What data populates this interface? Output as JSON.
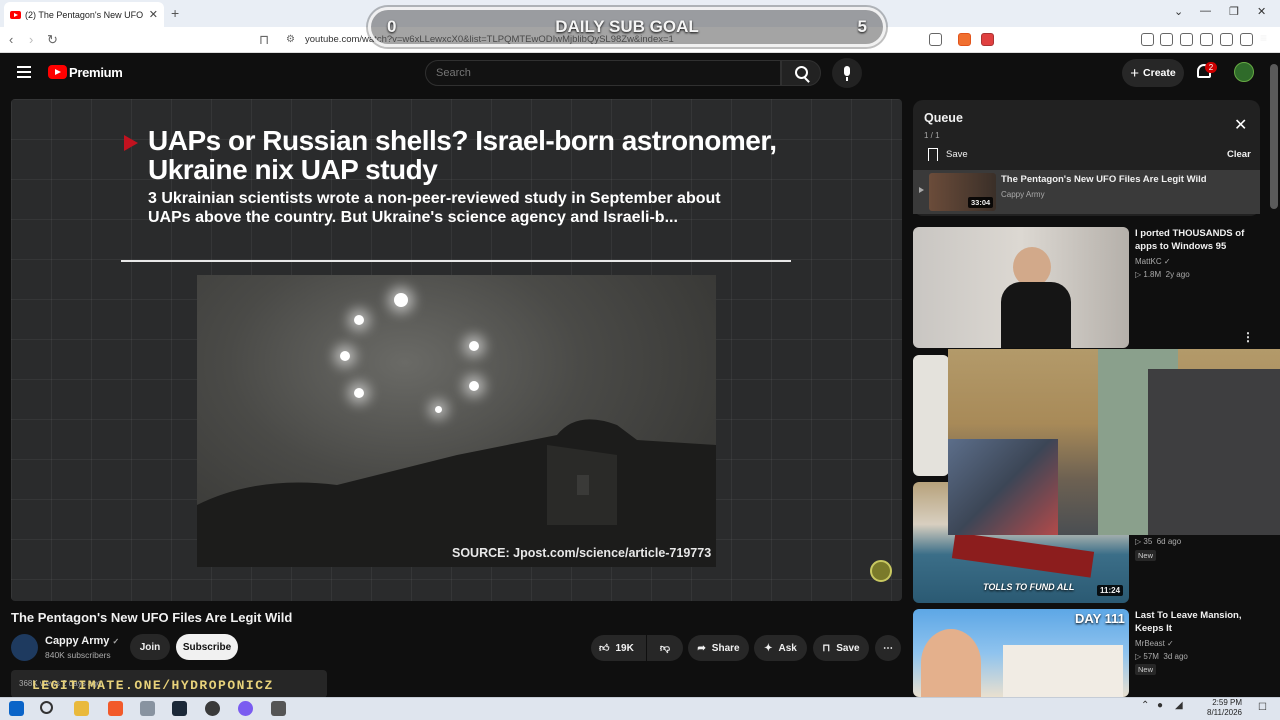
{
  "browser": {
    "tab_title": "(2) The Pentagon's New UFO",
    "url": "youtube.com/watch?v=w6xLLewxcX0&list=TLPQMTEwODIwMjblibQySL98Zw&index=1",
    "notification_count": "2"
  },
  "goal_overlay": {
    "current": "0",
    "label": "DAILY SUB GOAL",
    "target": "5"
  },
  "header": {
    "brand": "Premium",
    "search_placeholder": "Search",
    "create_label": "Create",
    "notification_badge": "2"
  },
  "video": {
    "headline_line1": "UAPs or Russian shells? Israel-born astronomer,",
    "headline_line2": "Ukraine nix UAP study",
    "subline1": "3 Ukrainian scientists wrote a non-peer-reviewed study in September about",
    "subline2": "UAPs above the country. But Ukraine's science agency and Israeli-b...",
    "source": "SOURCE: Jpost.com/science/article-719773",
    "title": "The Pentagon's New UFO Files Are Legit Wild",
    "channel": "Cappy Army",
    "subscribers": "840K subscribers",
    "join_label": "Join",
    "subscribe_label": "Subscribe",
    "likes": "19K",
    "share_label": "Share",
    "ask_label": "Ask",
    "save_label": "Save"
  },
  "promo": {
    "views": "368K views  2 days ago",
    "text": "LEGITIMATE.ONE/HYDROPONICZ"
  },
  "queue": {
    "title": "Queue",
    "count": "1 / 1",
    "save_label": "Save",
    "clear_label": "Clear",
    "item": {
      "title": "The Pentagon's New UFO Files Are Legit Wild",
      "channel": "Cappy Army",
      "duration": "33:04"
    }
  },
  "recommendations": [
    {
      "title": "I ported THOUSANDS of apps to Windows 95",
      "channel": "MattKC",
      "views": "1.8M",
      "age": "2y ago"
    },
    {
      "views": "35",
      "age": "6d ago",
      "badge": "New",
      "duration": "11:24",
      "thumb_text": "TOLLS TO FUND ALL"
    },
    {
      "title": "Last To Leave Mansion, Keeps It",
      "channel": "MrBeast",
      "views": "57M",
      "age": "3d ago",
      "badge": "New",
      "thumb_text": "DAY 111"
    }
  ],
  "taskbar": {
    "time": "2:59 PM",
    "date": "8/11/2026"
  },
  "colors": {
    "youtube_red": "#ff0000",
    "background": "#0f0f0f",
    "promo_text": "#e8d27a"
  }
}
